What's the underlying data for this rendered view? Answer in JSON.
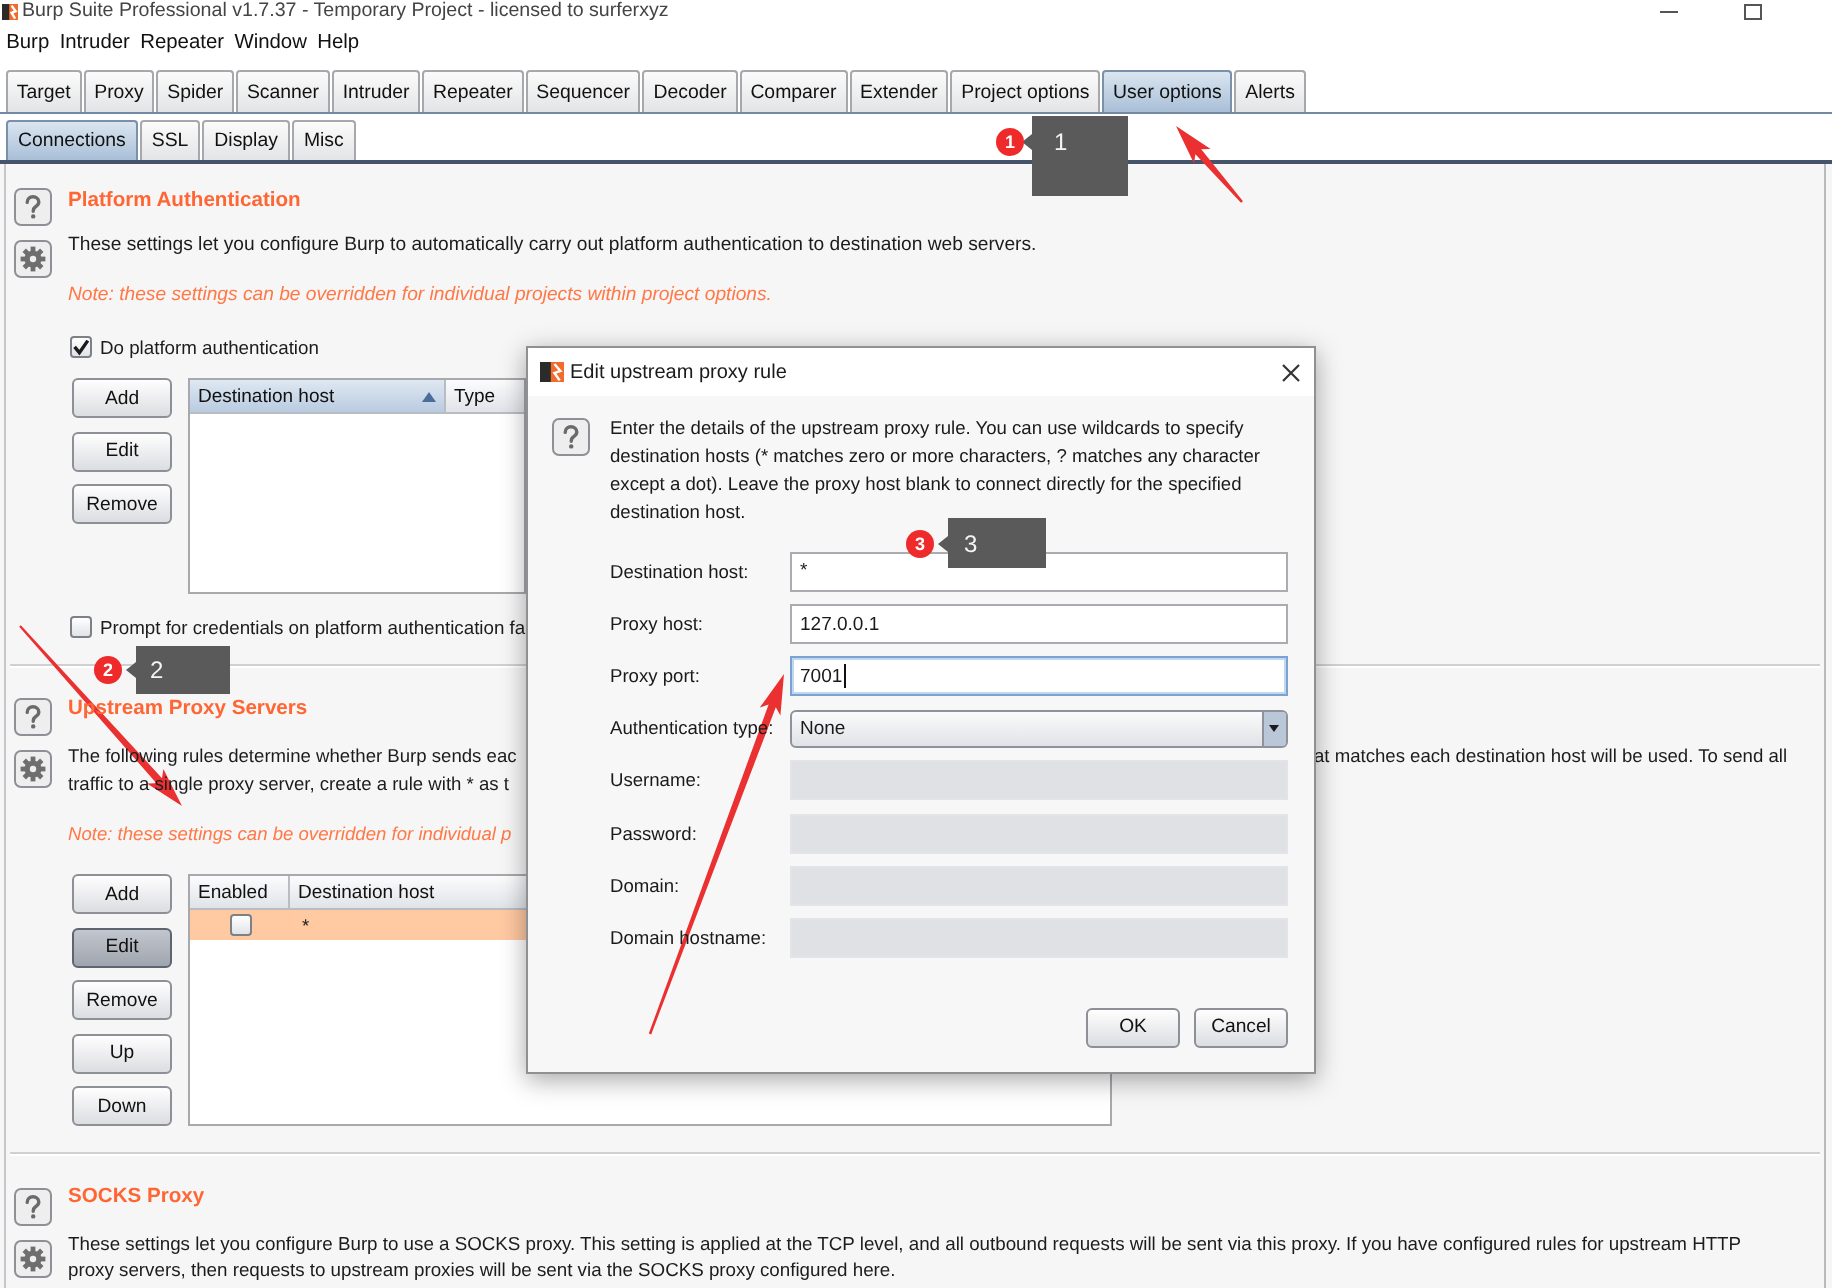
{
  "window": {
    "title": "Burp Suite Professional v1.7.37 - Temporary Project - licensed to surferxyz"
  },
  "menu": [
    "Burp",
    "Intruder",
    "Repeater",
    "Window",
    "Help"
  ],
  "tabs": [
    {
      "label": "Target",
      "selected": false
    },
    {
      "label": "Proxy",
      "selected": false
    },
    {
      "label": "Spider",
      "selected": false
    },
    {
      "label": "Scanner",
      "selected": false
    },
    {
      "label": "Intruder",
      "selected": false
    },
    {
      "label": "Repeater",
      "selected": false
    },
    {
      "label": "Sequencer",
      "selected": false
    },
    {
      "label": "Decoder",
      "selected": false
    },
    {
      "label": "Comparer",
      "selected": false
    },
    {
      "label": "Extender",
      "selected": false
    },
    {
      "label": "Project options",
      "selected": false
    },
    {
      "label": "User options",
      "selected": true
    },
    {
      "label": "Alerts",
      "selected": false
    }
  ],
  "subtabs": [
    {
      "label": "Connections",
      "selected": true
    },
    {
      "label": "SSL",
      "selected": false
    },
    {
      "label": "Display",
      "selected": false
    },
    {
      "label": "Misc",
      "selected": false
    }
  ],
  "platform_authentication": {
    "title": "Platform Authentication",
    "description": "These settings let you configure Burp to automatically carry out platform authentication to destination web servers.",
    "note": "Note: these settings can be overridden for individual projects within project options.",
    "enable_checkbox": {
      "label": "Do platform authentication",
      "checked": true
    },
    "buttons": [
      "Add",
      "Edit",
      "Remove"
    ],
    "table": {
      "columns": [
        {
          "label": "Destination host",
          "sorted": true
        },
        {
          "label": "Type",
          "sorted": false
        }
      ]
    },
    "prompt_checkbox": {
      "label": "Prompt for credentials on platform authentication fa",
      "checked": false
    }
  },
  "upstream_proxy_servers": {
    "title": "Upstream Proxy Servers",
    "description": {
      "left_lines": [
        "The following rules determine whether Burp sends eac",
        "traffic to a single proxy server, create a rule with * as t"
      ],
      "right_line": "at matches each destination host will be used. To send all"
    },
    "note": "Note: these settings can be overridden for individual p",
    "buttons": [
      {
        "label": "Add",
        "focused": false
      },
      {
        "label": "Edit",
        "focused": true
      },
      {
        "label": "Remove",
        "focused": false
      },
      {
        "label": "Up",
        "focused": false
      },
      {
        "label": "Down",
        "focused": false
      }
    ],
    "table": {
      "columns": [
        {
          "label": "Enabled",
          "sorted": false
        },
        {
          "label": "Destination host",
          "sorted": false
        }
      ],
      "rows": [
        {
          "selected": true,
          "enabled": false,
          "destination_host": "*"
        }
      ]
    }
  },
  "socks_proxy": {
    "title": "SOCKS Proxy",
    "description": "These settings let you configure Burp to use a SOCKS proxy. This setting is applied at the TCP level, and all outbound requests will be sent via this proxy. If you have configured rules for upstream HTTP proxy servers, then requests to upstream proxies will be sent via the SOCKS proxy configured here."
  },
  "dialog": {
    "title": "Edit upstream proxy rule",
    "instructions": "Enter the details of the upstream proxy rule. You can use wildcards to specify destination hosts (* matches zero or more characters, ? matches any character except a dot). Leave the proxy host blank to connect directly for the specified destination host.",
    "fields": [
      {
        "label": "Destination host:",
        "kind": "text",
        "value": "*",
        "disabled": false,
        "focused": false
      },
      {
        "label": "Proxy host:",
        "kind": "text",
        "value": "127.0.0.1",
        "disabled": false,
        "focused": false
      },
      {
        "label": "Proxy port:",
        "kind": "text",
        "value": "7001",
        "disabled": false,
        "focused": true
      },
      {
        "label": "Authentication type:",
        "kind": "select",
        "value": "None",
        "disabled": false,
        "focused": false
      },
      {
        "label": "Username:",
        "kind": "text",
        "disabled": true,
        "focused": false
      },
      {
        "label": "Password:",
        "kind": "text",
        "disabled": true,
        "focused": false
      },
      {
        "label": "Domain:",
        "kind": "text",
        "disabled": true,
        "focused": false
      },
      {
        "label": "Domain hostname:",
        "kind": "text",
        "disabled": true,
        "focused": false
      }
    ],
    "buttons": [
      "OK",
      "Cancel"
    ]
  },
  "annotations": [
    {
      "number": "1",
      "callout": "1"
    },
    {
      "number": "2",
      "callout": "2"
    },
    {
      "number": "3",
      "callout": "3"
    }
  ]
}
